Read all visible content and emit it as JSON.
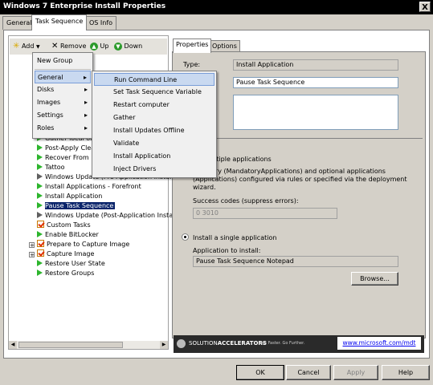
{
  "window": {
    "title": "Windows 7 Enterprise Install Properties",
    "close": "X"
  },
  "tabs": [
    "General",
    "Task Sequence",
    "OS Info"
  ],
  "toolbar": {
    "add": "Add",
    "remove": "Remove",
    "up": "Up",
    "down": "Down"
  },
  "tree": {
    "items": [
      {
        "label": "Gather local only",
        "icon": "play"
      },
      {
        "label": "Post-Apply Cleanup",
        "icon": "play"
      },
      {
        "label": "Recover From Domain",
        "icon": "play"
      },
      {
        "label": "Tattoo",
        "icon": "play"
      },
      {
        "label": "Windows Update (Pre-Application Installation)",
        "icon": "play-gray"
      },
      {
        "label": "Install Applications - Forefront",
        "icon": "play"
      },
      {
        "label": "Install Application",
        "icon": "play"
      },
      {
        "label": "Pause Task Sequence",
        "icon": "play",
        "selected": true
      },
      {
        "label": "Windows Update (Post-Application Installation)",
        "icon": "play-gray"
      },
      {
        "label": "Custom Tasks",
        "icon": "check"
      },
      {
        "label": "Enable BitLocker",
        "icon": "play"
      },
      {
        "label": "Prepare to Capture Image",
        "icon": "check",
        "expand": "+"
      },
      {
        "label": "Capture Image",
        "icon": "check",
        "expand": "+"
      },
      {
        "label": "Restore User State",
        "icon": "play"
      },
      {
        "label": "Restore Groups",
        "icon": "play"
      }
    ]
  },
  "add_menu": {
    "items": [
      "New Group",
      "General",
      "Disks",
      "Images",
      "Settings",
      "Roles"
    ],
    "submenu_arrow": "▸"
  },
  "general_submenu": {
    "items": [
      "Run Command Line",
      "Set Task Sequence Variable",
      "Restart computer",
      "Gather",
      "Install Updates Offline",
      "Validate",
      "Install Application",
      "Inject Drivers"
    ]
  },
  "right_tabs": [
    "Properties",
    "Options"
  ],
  "properties": {
    "type_label": "Type:",
    "type_value": "Install Application",
    "name_value": "Pause Task Sequence",
    "install_multiple": "ultiple applications",
    "multiple_desc": "andatory (MandatoryApplications) and optional applications (Applications) configured via rules or specified via the deployment wizard.",
    "success_label": "Success codes (suppress errors):",
    "success_value": "0 3010",
    "single_label": "Install a single application",
    "app_label": "Application to install:",
    "app_value": "Pause Task Sequence Notepad",
    "browse": "Browse..."
  },
  "banner": {
    "brand": "SOLUTION",
    "brand2": "ACCELERATORS",
    "tagline": "Act Faster. Go Further.",
    "link": "www.microsoft.com/mdt"
  },
  "buttons": {
    "ok": "OK",
    "cancel": "Cancel",
    "apply": "Apply",
    "help": "Help"
  },
  "colors": {
    "selection": "#0a246a",
    "menu_highlight": "#c9d9f0",
    "play": "#2db52d"
  }
}
